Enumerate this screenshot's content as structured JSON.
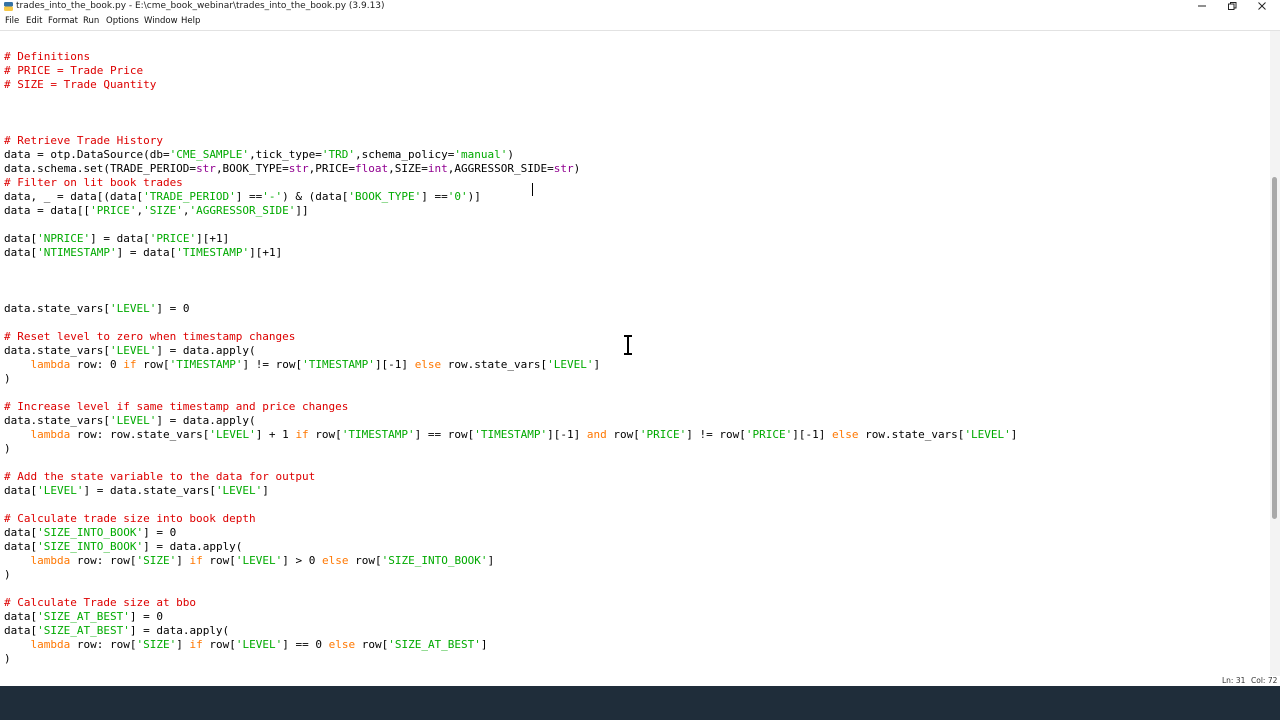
{
  "window": {
    "title": "trades_into_the_book.py - E:\\cme_book_webinar\\trades_into_the_book.py (3.9.13)"
  },
  "menu": [
    "File",
    "Edit",
    "Format",
    "Run",
    "Options",
    "Window",
    "Help"
  ],
  "status": {
    "line": "Ln: 31",
    "col": "Col: 72"
  },
  "colors": {
    "comment": "#dd0000",
    "string": "#00aa00",
    "keyword": "#ff7700",
    "builtin": "#900090",
    "taskbar": "#1f2d3a"
  },
  "icons": {
    "minimize": "minimize-icon",
    "restore": "restore-icon",
    "close": "close-icon",
    "app": "python-idle-icon",
    "pointer": "text-cursor-icon"
  },
  "code": [
    [
      {
        "t": "",
        "c": ""
      }
    ],
    [
      {
        "t": "# Definitions",
        "c": "c"
      }
    ],
    [
      {
        "t": "# PRICE = Trade Price",
        "c": "c"
      }
    ],
    [
      {
        "t": "# SIZE = Trade Quantity",
        "c": "c"
      }
    ],
    [
      {
        "t": "",
        "c": ""
      }
    ],
    [
      {
        "t": "",
        "c": ""
      }
    ],
    [
      {
        "t": "",
        "c": ""
      }
    ],
    [
      {
        "t": "# Retrieve Trade History",
        "c": "c"
      }
    ],
    [
      {
        "t": "data = otp.DataSource(db=",
        "c": ""
      },
      {
        "t": "'CME_SAMPLE'",
        "c": "s"
      },
      {
        "t": ",tick_type=",
        "c": ""
      },
      {
        "t": "'TRD'",
        "c": "s"
      },
      {
        "t": ",schema_policy=",
        "c": ""
      },
      {
        "t": "'manual'",
        "c": "s"
      },
      {
        "t": ")",
        "c": ""
      }
    ],
    [
      {
        "t": "data.schema.set(TRADE_PERIOD=",
        "c": ""
      },
      {
        "t": "str",
        "c": "b"
      },
      {
        "t": ",BOOK_TYPE=",
        "c": ""
      },
      {
        "t": "str",
        "c": "b"
      },
      {
        "t": ",PRICE=",
        "c": ""
      },
      {
        "t": "float",
        "c": "b"
      },
      {
        "t": ",SIZE=",
        "c": ""
      },
      {
        "t": "int",
        "c": "b"
      },
      {
        "t": ",AGGRESSOR_SIDE=",
        "c": ""
      },
      {
        "t": "str",
        "c": "b"
      },
      {
        "t": ")",
        "c": ""
      }
    ],
    [
      {
        "t": "# Filter on lit book trades",
        "c": "c"
      }
    ],
    [
      {
        "t": "data, _ = data[(data[",
        "c": ""
      },
      {
        "t": "'TRADE_PERIOD'",
        "c": "s"
      },
      {
        "t": "] ==",
        "c": ""
      },
      {
        "t": "'-'",
        "c": "s"
      },
      {
        "t": ") & (data[",
        "c": ""
      },
      {
        "t": "'BOOK_TYPE'",
        "c": "s"
      },
      {
        "t": "] ==",
        "c": ""
      },
      {
        "t": "'0'",
        "c": "s"
      },
      {
        "t": ")]",
        "c": ""
      }
    ],
    [
      {
        "t": "data = data[[",
        "c": ""
      },
      {
        "t": "'PRICE'",
        "c": "s"
      },
      {
        "t": ",",
        "c": ""
      },
      {
        "t": "'SIZE'",
        "c": "s"
      },
      {
        "t": ",",
        "c": ""
      },
      {
        "t": "'AGGRESSOR_SIDE'",
        "c": "s"
      },
      {
        "t": "]]",
        "c": ""
      }
    ],
    [
      {
        "t": "",
        "c": ""
      }
    ],
    [
      {
        "t": "data[",
        "c": ""
      },
      {
        "t": "'NPRICE'",
        "c": "s"
      },
      {
        "t": "] = data[",
        "c": ""
      },
      {
        "t": "'PRICE'",
        "c": "s"
      },
      {
        "t": "][+1]",
        "c": ""
      }
    ],
    [
      {
        "t": "data[",
        "c": ""
      },
      {
        "t": "'NTIMESTAMP'",
        "c": "s"
      },
      {
        "t": "] = data[",
        "c": ""
      },
      {
        "t": "'TIMESTAMP'",
        "c": "s"
      },
      {
        "t": "][+1]",
        "c": ""
      }
    ],
    [
      {
        "t": "",
        "c": ""
      }
    ],
    [
      {
        "t": "",
        "c": ""
      }
    ],
    [
      {
        "t": "",
        "c": ""
      }
    ],
    [
      {
        "t": "data.state_vars[",
        "c": ""
      },
      {
        "t": "'LEVEL'",
        "c": "s"
      },
      {
        "t": "] = 0",
        "c": ""
      }
    ],
    [
      {
        "t": "",
        "c": ""
      }
    ],
    [
      {
        "t": "# Reset level to zero when timestamp changes",
        "c": "c"
      }
    ],
    [
      {
        "t": "data.state_vars[",
        "c": ""
      },
      {
        "t": "'LEVEL'",
        "c": "s"
      },
      {
        "t": "] = data.apply(",
        "c": ""
      }
    ],
    [
      {
        "t": "    ",
        "c": ""
      },
      {
        "t": "lambda",
        "c": "k"
      },
      {
        "t": " row: 0 ",
        "c": ""
      },
      {
        "t": "if",
        "c": "k"
      },
      {
        "t": " row[",
        "c": ""
      },
      {
        "t": "'TIMESTAMP'",
        "c": "s"
      },
      {
        "t": "] != row[",
        "c": ""
      },
      {
        "t": "'TIMESTAMP'",
        "c": "s"
      },
      {
        "t": "][-1] ",
        "c": ""
      },
      {
        "t": "else",
        "c": "k"
      },
      {
        "t": " row.state_vars[",
        "c": ""
      },
      {
        "t": "'LEVEL'",
        "c": "s"
      },
      {
        "t": "]",
        "c": ""
      }
    ],
    [
      {
        "t": ")",
        "c": ""
      }
    ],
    [
      {
        "t": "",
        "c": ""
      }
    ],
    [
      {
        "t": "# Increase level if same timestamp and price changes",
        "c": "c"
      }
    ],
    [
      {
        "t": "data.state_vars[",
        "c": ""
      },
      {
        "t": "'LEVEL'",
        "c": "s"
      },
      {
        "t": "] = data.apply(",
        "c": ""
      }
    ],
    [
      {
        "t": "    ",
        "c": ""
      },
      {
        "t": "lambda",
        "c": "k"
      },
      {
        "t": " row: row.state_vars[",
        "c": ""
      },
      {
        "t": "'LEVEL'",
        "c": "s"
      },
      {
        "t": "] + 1 ",
        "c": ""
      },
      {
        "t": "if",
        "c": "k"
      },
      {
        "t": " row[",
        "c": ""
      },
      {
        "t": "'TIMESTAMP'",
        "c": "s"
      },
      {
        "t": "] == row[",
        "c": ""
      },
      {
        "t": "'TIMESTAMP'",
        "c": "s"
      },
      {
        "t": "][-1] ",
        "c": ""
      },
      {
        "t": "and",
        "c": "k"
      },
      {
        "t": " row[",
        "c": ""
      },
      {
        "t": "'PRICE'",
        "c": "s"
      },
      {
        "t": "] != row[",
        "c": ""
      },
      {
        "t": "'PRICE'",
        "c": "s"
      },
      {
        "t": "][-1] ",
        "c": ""
      },
      {
        "t": "else",
        "c": "k"
      },
      {
        "t": " row.state_vars[",
        "c": ""
      },
      {
        "t": "'LEVEL'",
        "c": "s"
      },
      {
        "t": "]",
        "c": ""
      }
    ],
    [
      {
        "t": ")",
        "c": ""
      }
    ],
    [
      {
        "t": "",
        "c": ""
      }
    ],
    [
      {
        "t": "# Add the state variable to the data for output",
        "c": "c"
      }
    ],
    [
      {
        "t": "data[",
        "c": ""
      },
      {
        "t": "'LEVEL'",
        "c": "s"
      },
      {
        "t": "] = data.state_vars[",
        "c": ""
      },
      {
        "t": "'LEVEL'",
        "c": "s"
      },
      {
        "t": "]",
        "c": ""
      }
    ],
    [
      {
        "t": "",
        "c": ""
      }
    ],
    [
      {
        "t": "# Calculate trade size into book depth",
        "c": "c"
      }
    ],
    [
      {
        "t": "data[",
        "c": ""
      },
      {
        "t": "'SIZE_INTO_BOOK'",
        "c": "s"
      },
      {
        "t": "] = 0",
        "c": ""
      }
    ],
    [
      {
        "t": "data[",
        "c": ""
      },
      {
        "t": "'SIZE_INTO_BOOK'",
        "c": "s"
      },
      {
        "t": "] = data.apply(",
        "c": ""
      }
    ],
    [
      {
        "t": "    ",
        "c": ""
      },
      {
        "t": "lambda",
        "c": "k"
      },
      {
        "t": " row: row[",
        "c": ""
      },
      {
        "t": "'SIZE'",
        "c": "s"
      },
      {
        "t": "] ",
        "c": ""
      },
      {
        "t": "if",
        "c": "k"
      },
      {
        "t": " row[",
        "c": ""
      },
      {
        "t": "'LEVEL'",
        "c": "s"
      },
      {
        "t": "] > 0 ",
        "c": ""
      },
      {
        "t": "else",
        "c": "k"
      },
      {
        "t": " row[",
        "c": ""
      },
      {
        "t": "'SIZE_INTO_BOOK'",
        "c": "s"
      },
      {
        "t": "]",
        "c": ""
      }
    ],
    [
      {
        "t": ")",
        "c": ""
      }
    ],
    [
      {
        "t": "",
        "c": ""
      }
    ],
    [
      {
        "t": "# Calculate Trade size at bbo",
        "c": "c"
      }
    ],
    [
      {
        "t": "data[",
        "c": ""
      },
      {
        "t": "'SIZE_AT_BEST'",
        "c": "s"
      },
      {
        "t": "] = 0",
        "c": ""
      }
    ],
    [
      {
        "t": "data[",
        "c": ""
      },
      {
        "t": "'SIZE_AT_BEST'",
        "c": "s"
      },
      {
        "t": "] = data.apply(",
        "c": ""
      }
    ],
    [
      {
        "t": "    ",
        "c": ""
      },
      {
        "t": "lambda",
        "c": "k"
      },
      {
        "t": " row: row[",
        "c": ""
      },
      {
        "t": "'SIZE'",
        "c": "s"
      },
      {
        "t": "] ",
        "c": ""
      },
      {
        "t": "if",
        "c": "k"
      },
      {
        "t": " row[",
        "c": ""
      },
      {
        "t": "'LEVEL'",
        "c": "s"
      },
      {
        "t": "] == 0 ",
        "c": ""
      },
      {
        "t": "else",
        "c": "k"
      },
      {
        "t": " row[",
        "c": ""
      },
      {
        "t": "'SIZE_AT_BEST'",
        "c": "s"
      },
      {
        "t": "]",
        "c": ""
      }
    ],
    [
      {
        "t": ")",
        "c": ""
      }
    ]
  ]
}
